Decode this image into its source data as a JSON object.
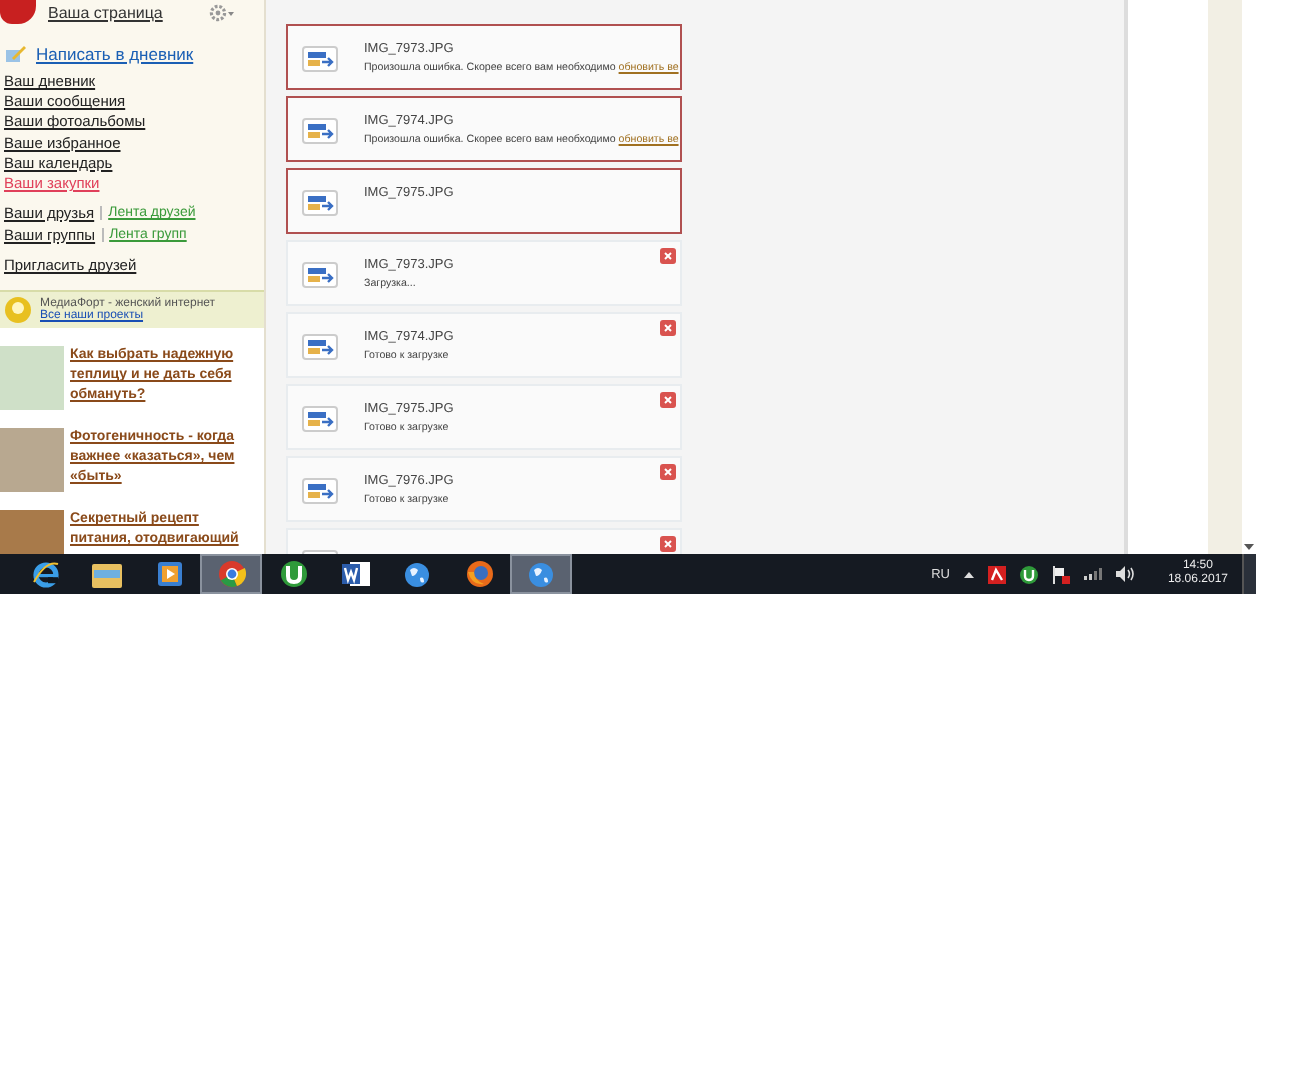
{
  "sidebar": {
    "profile_link": "Ваша страница",
    "write_link": "Написать в дневник",
    "links": [
      {
        "label": "Ваш дневник",
        "kind": "normal"
      },
      {
        "label": "Ваши сообщения",
        "kind": "normal"
      },
      {
        "label": "Ваши фотоальбомы",
        "kind": "normal"
      },
      {
        "label": "Ваше избранное",
        "kind": "normal"
      },
      {
        "label": "Ваш календарь",
        "kind": "normal"
      },
      {
        "label": "Ваши закупки",
        "kind": "highlight"
      }
    ],
    "social": [
      {
        "label": "Ваши друзья",
        "feed": "Лента друзей"
      },
      {
        "label": "Ваши группы",
        "feed": "Лента групп"
      }
    ],
    "invite": "Пригласить друзей",
    "banner": {
      "text": "МедиаФорт - женский интернет",
      "link": "Все наши проекты"
    },
    "articles": [
      {
        "title": "Как выбрать надежную теплицу и не дать себя обмануть?"
      },
      {
        "title": "Фотогеничность - когда важнее «казаться», чем «быть»"
      },
      {
        "title": "Секретный рецепт питания, отодвигающий"
      }
    ]
  },
  "uploads": [
    {
      "kind": "error",
      "name": "IMG_7973.JPG",
      "message": "Произошла ошибка. Скорее всего вам необходимо",
      "link": "обновить ве"
    },
    {
      "kind": "error",
      "name": "IMG_7974.JPG",
      "message": "Произошла ошибка. Скорее всего вам необходимо",
      "link": "обновить ве"
    },
    {
      "kind": "error",
      "name": "IMG_7975.JPG"
    },
    {
      "kind": "queued",
      "name": "IMG_7973.JPG",
      "status": "Загрузка..."
    },
    {
      "kind": "queued",
      "name": "IMG_7974.JPG",
      "status": "Готово к загрузке"
    },
    {
      "kind": "queued",
      "name": "IMG_7975.JPG",
      "status": "Готово к загрузке"
    },
    {
      "kind": "queued",
      "name": "IMG_7976.JPG",
      "status": "Готово к загрузке"
    },
    {
      "kind": "partial"
    }
  ],
  "taskbar": {
    "apps": [
      {
        "kind": "ie",
        "selected": false
      },
      {
        "kind": "folder",
        "selected": false
      },
      {
        "kind": "media",
        "selected": false
      },
      {
        "kind": "chrome",
        "selected": true
      },
      {
        "kind": "torrent",
        "selected": false
      },
      {
        "kind": "word",
        "selected": false
      },
      {
        "kind": "globe",
        "selected": false
      },
      {
        "kind": "firefox",
        "selected": false
      },
      {
        "kind": "globe",
        "selected": true
      }
    ],
    "language": "RU",
    "time": "14:50",
    "date": "18.06.2017"
  }
}
